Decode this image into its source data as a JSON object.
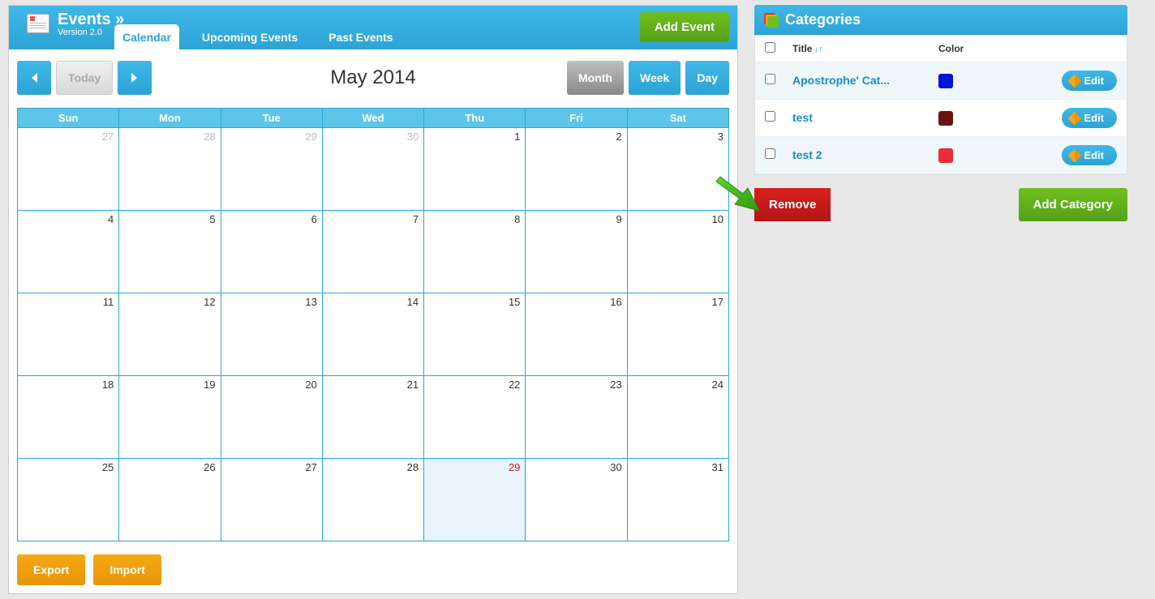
{
  "app": {
    "title": "Events »",
    "version": "Version 2.0"
  },
  "tabs": [
    {
      "label": "Calendar",
      "active": true
    },
    {
      "label": "Upcoming Events",
      "active": false
    },
    {
      "label": "Past Events",
      "active": false
    }
  ],
  "addEventLabel": "Add Event",
  "nav": {
    "today": "Today",
    "monthTitle": "May 2014"
  },
  "views": [
    {
      "label": "Month",
      "selected": true
    },
    {
      "label": "Week",
      "selected": false
    },
    {
      "label": "Day",
      "selected": false
    }
  ],
  "weekdays": [
    "Sun",
    "Mon",
    "Tue",
    "Wed",
    "Thu",
    "Fri",
    "Sat"
  ],
  "weeks": [
    [
      {
        "n": "27",
        "other": true
      },
      {
        "n": "28",
        "other": true
      },
      {
        "n": "29",
        "other": true
      },
      {
        "n": "30",
        "other": true
      },
      {
        "n": "1"
      },
      {
        "n": "2"
      },
      {
        "n": "3"
      }
    ],
    [
      {
        "n": "4"
      },
      {
        "n": "5"
      },
      {
        "n": "6"
      },
      {
        "n": "7"
      },
      {
        "n": "8"
      },
      {
        "n": "9"
      },
      {
        "n": "10"
      }
    ],
    [
      {
        "n": "11"
      },
      {
        "n": "12"
      },
      {
        "n": "13"
      },
      {
        "n": "14"
      },
      {
        "n": "15"
      },
      {
        "n": "16"
      },
      {
        "n": "17"
      }
    ],
    [
      {
        "n": "18"
      },
      {
        "n": "19"
      },
      {
        "n": "20"
      },
      {
        "n": "21"
      },
      {
        "n": "22"
      },
      {
        "n": "23"
      },
      {
        "n": "24"
      }
    ],
    [
      {
        "n": "25"
      },
      {
        "n": "26"
      },
      {
        "n": "27"
      },
      {
        "n": "28"
      },
      {
        "n": "29",
        "today": true
      },
      {
        "n": "30"
      },
      {
        "n": "31"
      }
    ]
  ],
  "footer": {
    "export": "Export",
    "import": "Import"
  },
  "categories": {
    "title": "Categories",
    "cols": {
      "title": "Title",
      "color": "Color"
    },
    "editLabel": "Edit",
    "rows": [
      {
        "title": "Apostrophe' Cat...",
        "color": "#0014d4"
      },
      {
        "title": "test",
        "color": "#6b1414"
      },
      {
        "title": "test 2",
        "color": "#ed2b3a"
      }
    ],
    "removeLabel": "Remove",
    "addLabel": "Add Category"
  }
}
